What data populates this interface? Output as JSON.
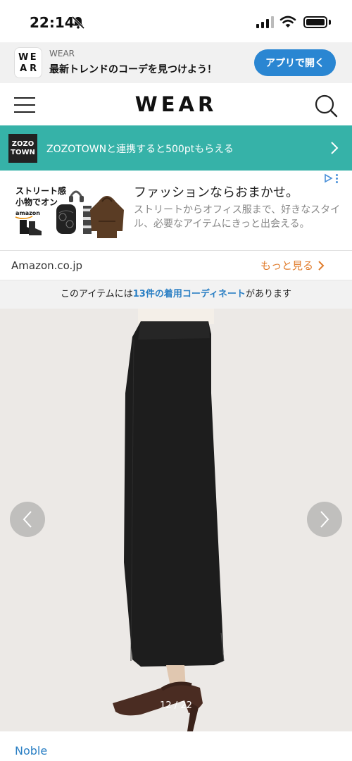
{
  "status_bar": {
    "time": "22:14",
    "icons": [
      "bell-slash-icon",
      "signal-icon",
      "wifi-icon",
      "battery-icon"
    ]
  },
  "app_banner": {
    "icon_letters": [
      "W",
      "E",
      "A",
      "R"
    ],
    "app_name": "WEAR",
    "tagline": "最新トレンドのコーデを見つけよう！",
    "open_button": "アプリで開く",
    "accent_color": "#2a86d2"
  },
  "header": {
    "logo": "WEAR",
    "icons": [
      "hamburger-menu-icon",
      "search-icon"
    ]
  },
  "zozo_bar": {
    "logo_line1": "ZOZO",
    "logo_line2": "TOWN",
    "text": "ZOZOTOWNと連携すると500ptもらえる",
    "background": "#36b2a8"
  },
  "ad": {
    "image_text_line1": "ストリート感",
    "image_text_line2": "小物でオン",
    "image_brand": "amazon",
    "headline": "ファッションならおまかせ。",
    "body": "ストリートからオフィス服まで、好きなスタイル、必要なアイテムにきっと出会える。",
    "domain": "Amazon.co.jp",
    "cta": "もっと見る",
    "cta_color": "#e07c2c"
  },
  "notice": {
    "prefix": "このアイテムには",
    "link": "13件の着用コーディネート",
    "suffix": "があります"
  },
  "carousel": {
    "current": "12",
    "separator": "/",
    "total": "22"
  },
  "brand": {
    "name": "Noble"
  }
}
